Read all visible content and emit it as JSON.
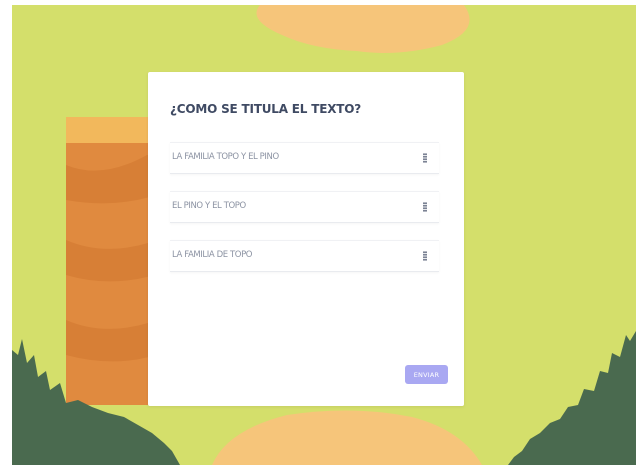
{
  "quiz": {
    "question": "¿COMO SE TITULA EL TEXTO?",
    "options": [
      {
        "label": "LA FAMILIA TOPO Y EL PINO"
      },
      {
        "label": "EL PINO Y EL TOPO"
      },
      {
        "label": "LA FAMILIA DE TOPO"
      }
    ],
    "submit_label": "ENVIAR"
  },
  "colors": {
    "background": "#d4df6b",
    "accent_orange": "#f6c57a",
    "tree_trunk": "#e08a3f",
    "forest_green": "#4a6a4f",
    "submit_button": "#a9a8f2",
    "question_text": "#3f4a63"
  },
  "icons": {
    "option_handle": "drag-handle-icon"
  }
}
